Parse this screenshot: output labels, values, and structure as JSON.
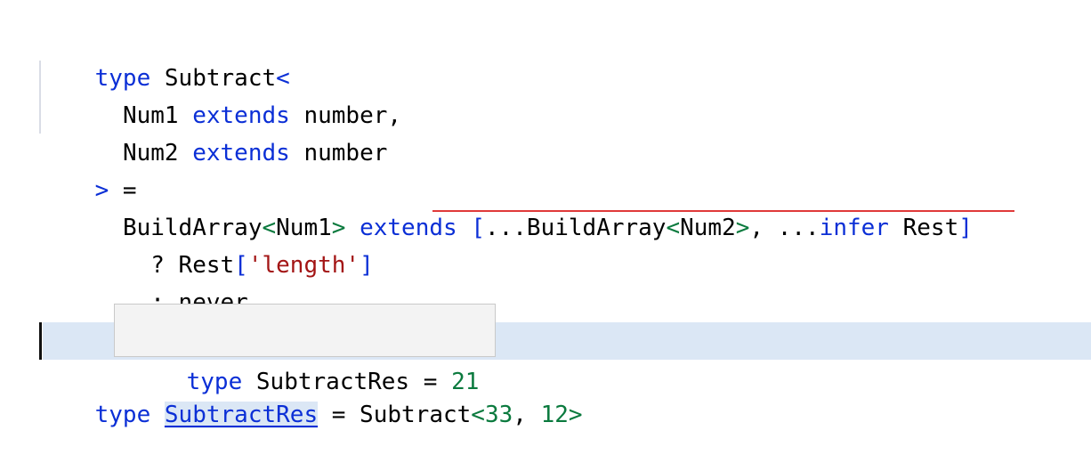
{
  "editor": {
    "lines": {
      "l1": {
        "type_kw": "type",
        "name": " Subtract",
        "open": "<"
      },
      "l2": {
        "indent": "  ",
        "param": "Num1",
        "ext": "extends",
        "rest": " number,"
      },
      "l3": {
        "indent": "  ",
        "param": "Num2",
        "ext": "extends",
        "rest": " number"
      },
      "l4": {
        "close": ">",
        "eq": " ="
      },
      "l5": {
        "indent": "  ",
        "a": "BuildArray",
        "a_open": "<",
        "a_arg": "Num1",
        "a_close": ">",
        "ext": "extends",
        "bracket_open": "[",
        "spread": "...BuildArray",
        "b_open": "<",
        "b_arg": "Num2",
        "b_close": ">",
        "comma": ", ...",
        "infer": "infer",
        "rest": " Rest",
        "bracket_close": "]"
      },
      "l6": {
        "indent": "    ",
        "q": "? Rest",
        "br_open": "[",
        "str": "'length'",
        "br_close": "]"
      },
      "l7": {
        "indent": "    ",
        "colon": ": never"
      },
      "l9": {
        "type_kw": "type",
        "ident": "SubtractRes",
        "eq": " = Subtract",
        "open": "<",
        "n1": "33",
        "comma": ", ",
        "n2": "12",
        "close": ">"
      }
    },
    "tooltip": {
      "type_kw": "type",
      "text": " SubtractRes = ",
      "value": "21"
    },
    "colors": {
      "keyword": "#0b2fd6",
      "number": "#0b7a3e",
      "string": "#a31515",
      "error_underline": "#e03a3a",
      "current_line": "#dbe7f5"
    }
  }
}
